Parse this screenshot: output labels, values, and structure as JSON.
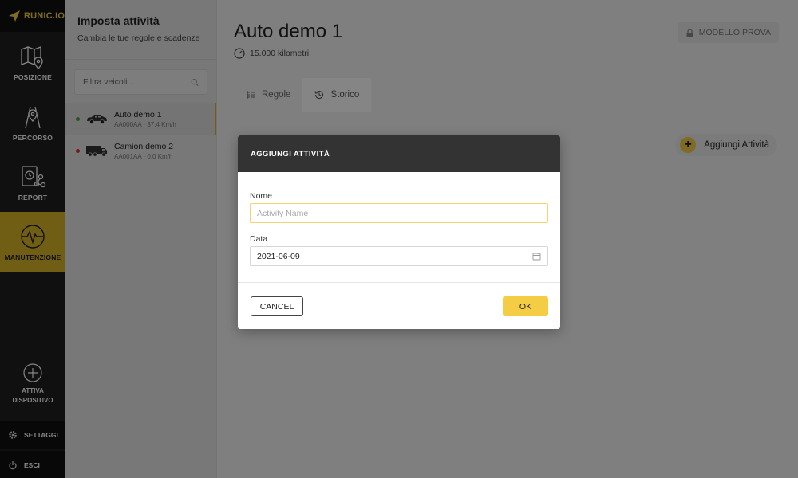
{
  "app": {
    "logo_text": "RUNIC.IO"
  },
  "rail": {
    "items": [
      {
        "label": "POSIZIONE",
        "icon": "map-pin-icon"
      },
      {
        "label": "PERCORSO",
        "icon": "route-icon"
      },
      {
        "label": "REPORT",
        "icon": "report-icon"
      },
      {
        "label": "MANUTENZIONE",
        "icon": "maintenance-icon",
        "active": true
      }
    ],
    "activate_label_1": "ATTIVA",
    "activate_label_2": "DISPOSITIVO",
    "settings_label": "SETTAGGI",
    "logout_label": "ESCI"
  },
  "panel": {
    "title": "Imposta attività",
    "subtitle": "Cambia le tue regole e scadenze",
    "search_placeholder": "Filtra veicoli...",
    "vehicles": [
      {
        "name": "Auto demo 1",
        "info": "AA000AA · 37.4 Km/h",
        "status_color": "#3fa535",
        "icon": "car-icon",
        "active": true
      },
      {
        "name": "Camion demo 2",
        "info": "AA001AA · 0.0 Km/h",
        "status_color": "#d93025",
        "icon": "truck-icon",
        "active": false
      }
    ]
  },
  "main": {
    "title": "Auto demo 1",
    "km": "15.000 kilometri",
    "trial_label": "MODELLO PROVA",
    "tabs": [
      {
        "label": "Regole",
        "active": false
      },
      {
        "label": "Storico",
        "active": true
      }
    ],
    "add_label": "Aggiungi Attività"
  },
  "modal": {
    "title": "AGGIUNGI ATTIVITÀ",
    "name_label": "Nome",
    "name_placeholder": "Activity Name",
    "date_label": "Data",
    "date_value": "2021-06-09",
    "cancel_label": "CANCEL",
    "ok_label": "OK"
  },
  "colors": {
    "accent": "#f4cd45",
    "rail_bg": "#1f1f1f",
    "active_nav": "#d9b52a"
  }
}
